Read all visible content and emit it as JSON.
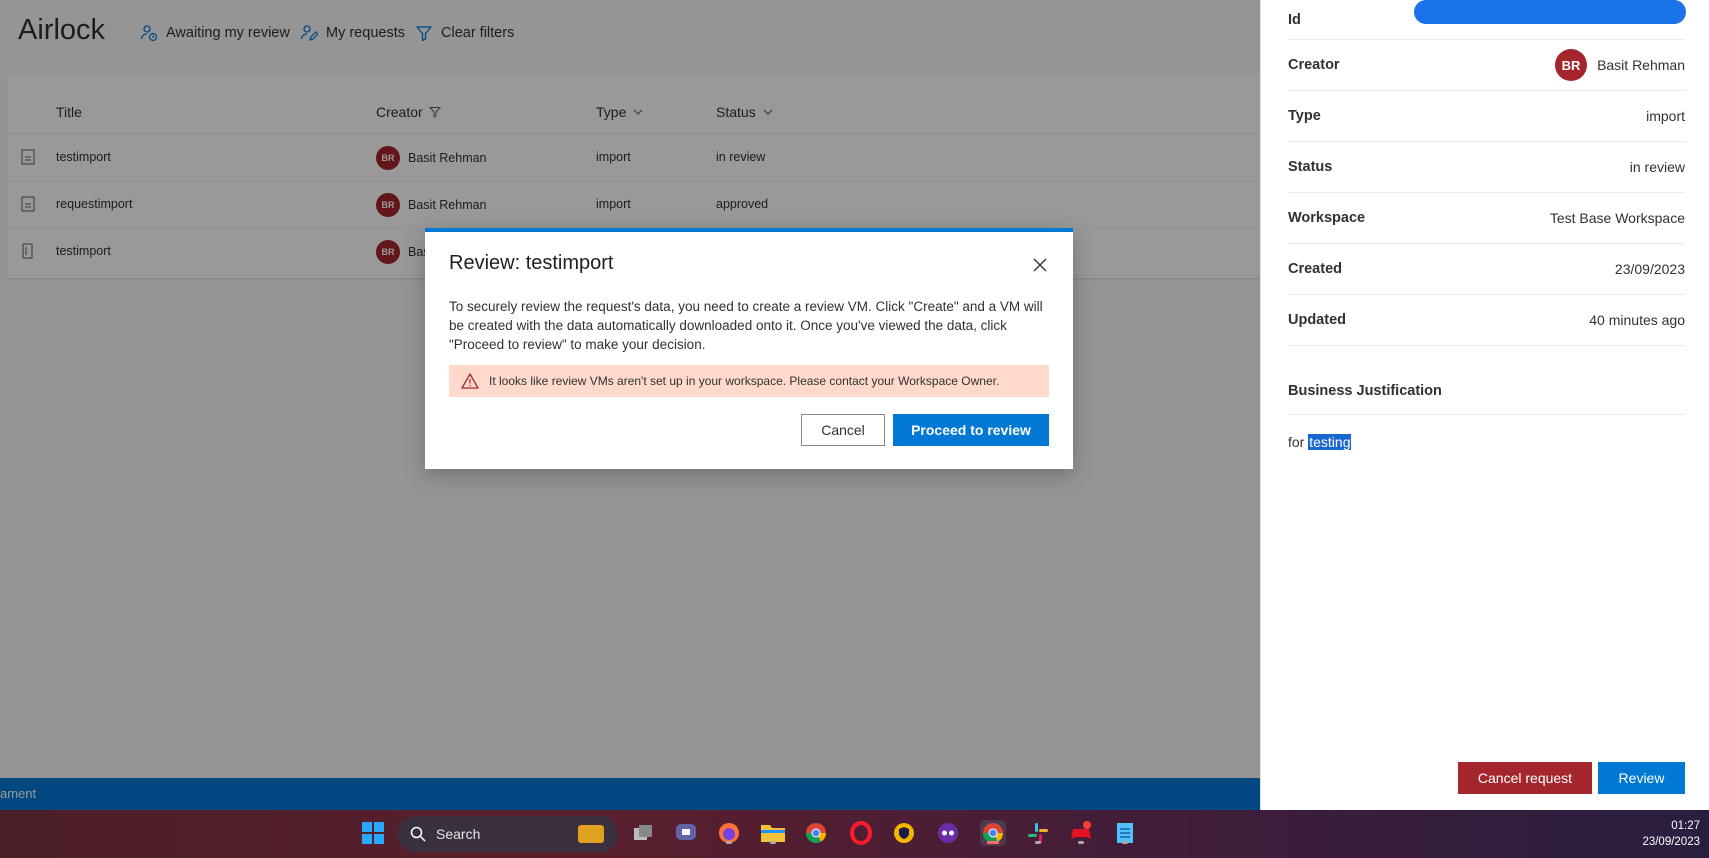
{
  "app": {
    "title": "Airlock",
    "commands": {
      "awaiting": "Awaiting my review",
      "my_requests": "My requests",
      "clear_filters": "Clear filters"
    },
    "columns": {
      "title": "Title",
      "creator": "Creator",
      "type": "Type",
      "status": "Status"
    },
    "rows": [
      {
        "title": "testimport",
        "initials": "BR",
        "creator": "Basit Rehman",
        "type": "import",
        "status": "in review"
      },
      {
        "title": "requestimport",
        "initials": "BR",
        "creator": "Basit Rehman",
        "type": "import",
        "status": "approved"
      },
      {
        "title": "testimport",
        "initials": "BR",
        "creator": "Bas",
        "type": "",
        "status": ""
      }
    ],
    "status_bar_text": "ament"
  },
  "panel": {
    "id_label": "Id",
    "creator_label": "Creator",
    "creator_initials": "BR",
    "creator_name": "Basit Rehman",
    "type_label": "Type",
    "type_value": "import",
    "status_label": "Status",
    "status_value": "in review",
    "workspace_label": "Workspace",
    "workspace_value": "Test Base Workspace",
    "created_label": "Created",
    "created_value": "23/09/2023",
    "updated_label": "Updated",
    "updated_value": "40 minutes ago",
    "business_justification_label": "Business Justification",
    "justification_prefix": "for",
    "justification_selected": "testing",
    "cancel_request_label": "Cancel request",
    "review_label": "Review"
  },
  "dialog": {
    "title": "Review: testimport",
    "body": "To securely review the request's data, you need to create a review VM. Click \"Create\" and a VM will be created with the data automatically downloaded onto it. Once you've viewed the data, click \"Proceed to review\" to make your decision.",
    "warning": "It looks like review VMs aren't set up in your workspace. Please contact your Workspace Owner.",
    "cancel_label": "Cancel",
    "proceed_label": "Proceed to review"
  },
  "taskbar": {
    "search_label": "Search",
    "time": "01:27",
    "date": "23/09/2023"
  },
  "colors": {
    "accent": "#0078d4",
    "danger": "#a4262c",
    "warning_bg": "#fed9cc"
  }
}
